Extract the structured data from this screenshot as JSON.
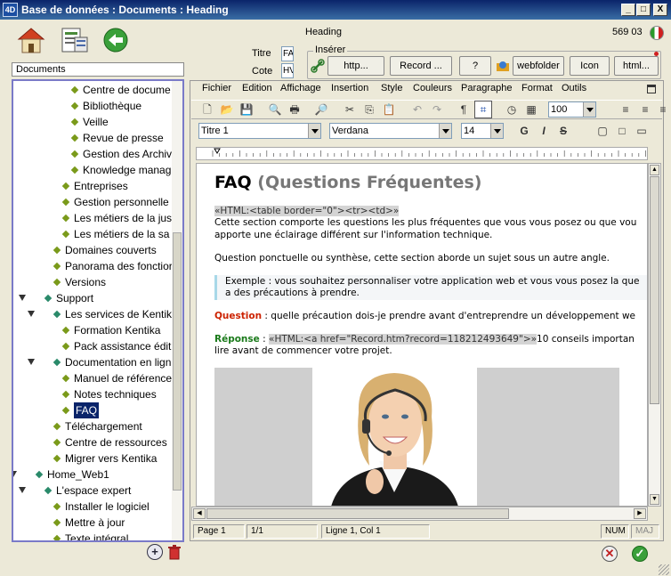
{
  "window": {
    "title": "Base de données : Documents : Heading",
    "logo": "4D",
    "minimize": "_",
    "maximize": "□",
    "close": "X"
  },
  "header": {
    "record_label": "Heading",
    "record_number": "569 03",
    "titre_label": "Titre",
    "titre_value": "FA",
    "cote_label": "Cote",
    "cote_value": "HV"
  },
  "insert": {
    "legend": "Insérer",
    "buttons": [
      "http...",
      "Record ...",
      "?",
      "webfolder",
      "Icon",
      "html..."
    ]
  },
  "tree": {
    "header": "Documents",
    "nodes": [
      {
        "label": "Centre de docume",
        "level": 3
      },
      {
        "label": "Bibliothèque",
        "level": 3
      },
      {
        "label": "Veille",
        "level": 3
      },
      {
        "label": "Revue de presse",
        "level": 3
      },
      {
        "label": "Gestion des Archiv",
        "level": 3
      },
      {
        "label": "Knowledge manag",
        "level": 3
      },
      {
        "label": "Entreprises",
        "level": 2
      },
      {
        "label": "Gestion personnelle",
        "level": 2
      },
      {
        "label": "Les métiers de la jus",
        "level": 2
      },
      {
        "label": "Les métiers de la sa",
        "level": 2
      },
      {
        "label": "Domaines couverts",
        "level": 1
      },
      {
        "label": "Panorama des fonctior",
        "level": 1
      },
      {
        "label": "Versions",
        "level": 1
      },
      {
        "label": "Support",
        "level": 0,
        "expanded": true
      },
      {
        "label": "Les services de Kentik",
        "level": 1,
        "expanded": true
      },
      {
        "label": "Formation Kentika",
        "level": 2
      },
      {
        "label": "Pack assistance édit",
        "level": 2
      },
      {
        "label": "Documentation en lign",
        "level": 1,
        "expanded": true
      },
      {
        "label": "Manuel de référence",
        "level": 2
      },
      {
        "label": "Notes techniques",
        "level": 2
      },
      {
        "label": "FAQ",
        "level": 2,
        "selected": true
      },
      {
        "label": "Téléchargement",
        "level": 1
      },
      {
        "label": "Centre de ressources",
        "level": 1
      },
      {
        "label": "Migrer vers Kentika",
        "level": 1
      },
      {
        "label": "Home_Web1",
        "level": -1,
        "expanded": true
      },
      {
        "label": "L'espace expert",
        "level": 0,
        "expanded": true
      },
      {
        "label": "Installer le logiciel",
        "level": 1
      },
      {
        "label": "Mettre à jour",
        "level": 1
      },
      {
        "label": "Texte intégral",
        "level": 1
      }
    ]
  },
  "menu": [
    "Fichier",
    "Edition",
    "Affichage",
    "Insertion",
    "Style",
    "Couleurs",
    "Paragraphe",
    "Format",
    "Outils"
  ],
  "format": {
    "style": "Titre 1",
    "font": "Verdana",
    "size": "14",
    "zoom": "100",
    "bold": "G",
    "italic": "I",
    "strike": "S"
  },
  "document": {
    "title_strong": "FAQ",
    "title_rest": "(Questions Fréquentes)",
    "tag1": "«HTML:<table border=\"0\"><tr><td>»",
    "line1": "Cette section comporte les questions les plus fréquentes que vous vous posez ou que vou",
    "line2": "apporte une éclairage différent sur l'information technique.",
    "line3": "Question ponctuelle ou synthèse, cette section aborde un sujet sous un autre angle.",
    "quote1": "Exemple : vous souhaitez personnaliser votre application web et vous vous posez la que",
    "quote2": "a des précautions à prendre.",
    "q_label": "Question",
    "q_text": " : quelle précaution dois-je prendre avant d'entreprendre un développement we",
    "r_label": "Réponse",
    "r_sep": " : ",
    "r_tag": "«HTML:<a href=\"Record.htm?record=118212493649\">»",
    "r_text": "10 conseils importan",
    "r_line2": "lire avant de commencer votre projet."
  },
  "status": {
    "page": "Page 1",
    "pages": "1/1",
    "position": "Ligne 1, Col 1",
    "num": "NUM",
    "maj": "MAJ"
  },
  "colors": {
    "question": "#cc2200",
    "reponse": "#1a7a1a",
    "selection": "#0a246a"
  }
}
